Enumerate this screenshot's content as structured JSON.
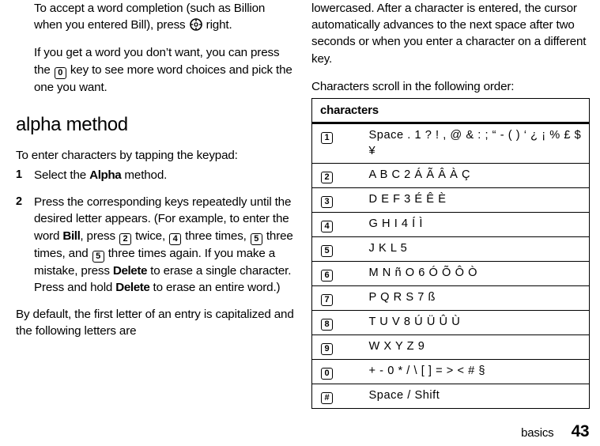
{
  "page": {
    "footer_section": "basics",
    "footer_page_number": "43"
  },
  "left_column": {
    "para_accept": {
      "before_key": "To accept a word completion (such as Billion when you entered Bill), press",
      "key_icon": "navigation-key-icon",
      "after_key": "right."
    },
    "para_more_choices": {
      "before_key": "If you get a word you don’t want, you can press the",
      "key_label": "0",
      "after_key": "key to see more word choices and pick the one you want."
    },
    "section_heading": "alpha method",
    "intro": "To enter characters by tapping the keypad:",
    "steps": [
      {
        "number": "1",
        "parts": [
          {
            "type": "text",
            "value": "Select the "
          },
          {
            "type": "bold",
            "value": "Alpha"
          },
          {
            "type": "text",
            "value": " method."
          }
        ]
      },
      {
        "number": "2",
        "parts": [
          {
            "type": "text",
            "value": "Press the corresponding keys repeatedly until the desired letter appears. (For example, to enter the word "
          },
          {
            "type": "bold",
            "value": "Bill"
          },
          {
            "type": "text",
            "value": ", press "
          },
          {
            "type": "key",
            "value": "2"
          },
          {
            "type": "text",
            "value": " twice, "
          },
          {
            "type": "key",
            "value": "4"
          },
          {
            "type": "text",
            "value": " three times, "
          },
          {
            "type": "key",
            "value": "5"
          },
          {
            "type": "text",
            "value": " three times, and "
          },
          {
            "type": "key",
            "value": "5"
          },
          {
            "type": "text",
            "value": " three times again. If you make a mistake, press "
          },
          {
            "type": "bold",
            "value": "Delete"
          },
          {
            "type": "text",
            "value": " to erase a single character. Press and hold "
          },
          {
            "type": "bold",
            "value": "Delete"
          },
          {
            "type": "text",
            "value": " to erase an entire word.)"
          }
        ]
      }
    ],
    "para_default_caps": "By default, the first letter of an entry is capitalized and the following letters are"
  },
  "right_column": {
    "para_lowercased": "lowercased. After a character is entered, the cursor automatically advances to the next space after two seconds or when you enter a character on a different key.",
    "para_scroll_order": "Characters scroll in the following order:",
    "table": {
      "header": "characters",
      "rows": [
        {
          "key": "1",
          "chars": "Space . 1 ? ! , @ & : ; “ - ( ) ‘ ¿ ¡ % £ $ ¥"
        },
        {
          "key": "2",
          "chars": "A B C 2 Á Ã Â À Ç"
        },
        {
          "key": "3",
          "chars": "D E F 3 É Ê È"
        },
        {
          "key": "4",
          "chars": "G H I 4 Í Ì"
        },
        {
          "key": "5",
          "chars": "J K L 5"
        },
        {
          "key": "6",
          "chars": "M N ñ O 6 Ó Õ Ô Ò"
        },
        {
          "key": "7",
          "chars": "P Q R S 7 ß"
        },
        {
          "key": "8",
          "chars": "T U V 8 Ú Ü Û Ù"
        },
        {
          "key": "9",
          "chars": "W X Y Z 9"
        },
        {
          "key": "0",
          "chars": "+ - 0 * / \\ [ ] = > < # §"
        },
        {
          "key": "#",
          "chars": "Space / Shift"
        }
      ]
    }
  }
}
